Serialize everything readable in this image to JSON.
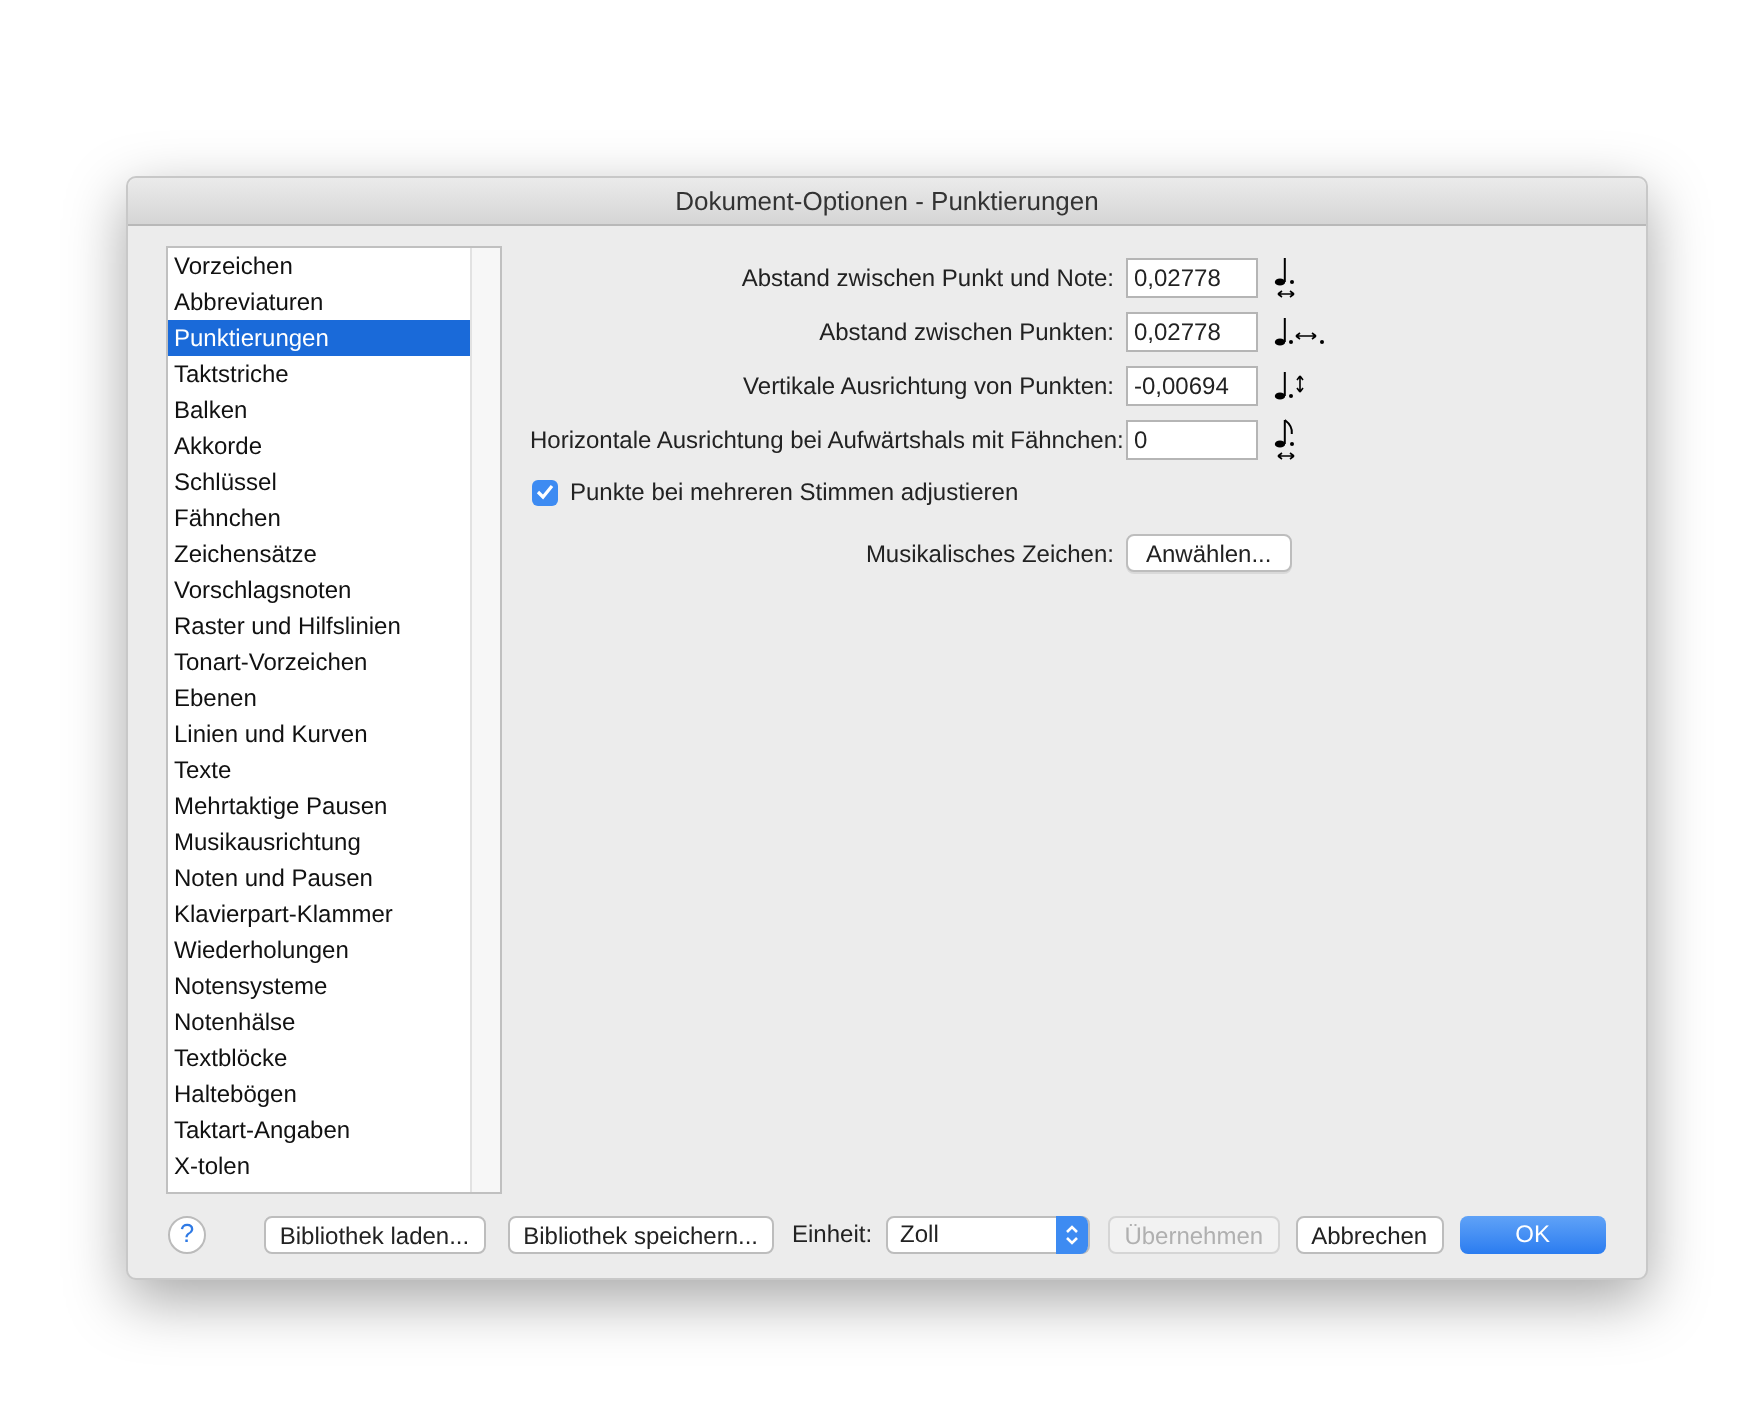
{
  "window": {
    "title": "Dokument-Optionen - Punktierungen"
  },
  "sidebar": {
    "items": [
      {
        "label": "Vorzeichen",
        "selected": false
      },
      {
        "label": "Abbreviaturen",
        "selected": false
      },
      {
        "label": "Punktierungen",
        "selected": true
      },
      {
        "label": "Taktstriche",
        "selected": false
      },
      {
        "label": "Balken",
        "selected": false
      },
      {
        "label": "Akkorde",
        "selected": false
      },
      {
        "label": "Schlüssel",
        "selected": false
      },
      {
        "label": "Fähnchen",
        "selected": false
      },
      {
        "label": "Zeichensätze",
        "selected": false
      },
      {
        "label": "Vorschlagsnoten",
        "selected": false
      },
      {
        "label": "Raster und Hilfslinien",
        "selected": false
      },
      {
        "label": "Tonart-Vorzeichen",
        "selected": false
      },
      {
        "label": "Ebenen",
        "selected": false
      },
      {
        "label": "Linien und Kurven",
        "selected": false
      },
      {
        "label": "Texte",
        "selected": false
      },
      {
        "label": "Mehrtaktige Pausen",
        "selected": false
      },
      {
        "label": "Musikausrichtung",
        "selected": false
      },
      {
        "label": "Noten und Pausen",
        "selected": false
      },
      {
        "label": "Klavierpart-Klammer",
        "selected": false
      },
      {
        "label": "Wiederholungen",
        "selected": false
      },
      {
        "label": "Notensysteme",
        "selected": false
      },
      {
        "label": "Notenhälse",
        "selected": false
      },
      {
        "label": "Textblöcke",
        "selected": false
      },
      {
        "label": "Haltebögen",
        "selected": false
      },
      {
        "label": "Taktart-Angaben",
        "selected": false
      },
      {
        "label": "X-tolen",
        "selected": false
      }
    ]
  },
  "fields": [
    {
      "label": "Abstand zwischen Punkt und Note:",
      "value": "0,02778"
    },
    {
      "label": "Abstand zwischen Punkten:",
      "value": "0,02778"
    },
    {
      "label": "Vertikale Ausrichtung von Punkten:",
      "value": "-0,00694"
    },
    {
      "label": "Horizontale Ausrichtung bei Aufwärtshals mit Fähnchen:",
      "value": "0"
    }
  ],
  "checkbox": {
    "label": "Punkte bei mehreren Stimmen adjustieren",
    "checked": true
  },
  "symbol": {
    "label": "Musikalisches Zeichen:",
    "button": "Anwählen..."
  },
  "footer": {
    "help": "?",
    "load": "Bibliothek laden...",
    "save": "Bibliothek speichern...",
    "unit_label": "Einheit:",
    "unit": "Zoll",
    "apply": {
      "label": "Übernehmen",
      "disabled": true
    },
    "cancel": "Abbrechen",
    "ok": "OK"
  }
}
